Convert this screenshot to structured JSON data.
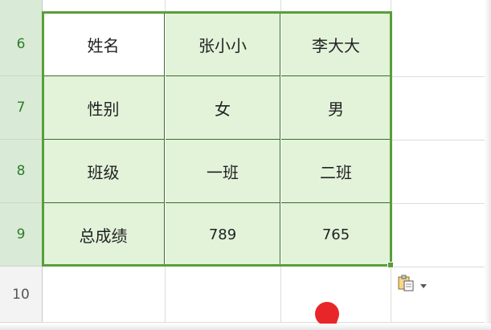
{
  "row_headers": [
    {
      "label": "6",
      "selected": true
    },
    {
      "label": "7",
      "selected": true
    },
    {
      "label": "8",
      "selected": true
    },
    {
      "label": "9",
      "selected": true
    },
    {
      "label": "10",
      "selected": false
    }
  ],
  "table": {
    "rows": [
      [
        "姓名",
        "张小小",
        "李大大"
      ],
      [
        "性别",
        "女",
        "男"
      ],
      [
        "班级",
        "一班",
        "二班"
      ],
      [
        "总成绩",
        "789",
        "765"
      ]
    ]
  },
  "paste_options": {
    "icon": "clipboard-icon",
    "dropdown_icon": "chevron-down-icon"
  },
  "colors": {
    "selection_border": "#5a9e3a",
    "selection_fill": "#e2f3da",
    "row_header_selected": "#d9ead6",
    "row_header_text": "#2f7d2a"
  }
}
